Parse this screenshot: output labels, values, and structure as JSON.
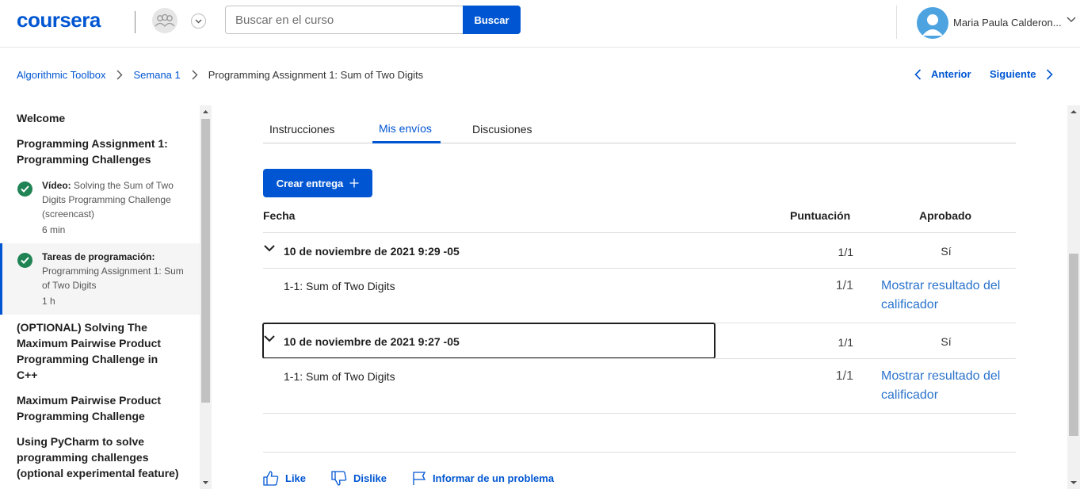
{
  "header": {
    "logo": "coursera",
    "search_placeholder": "Buscar en el curso",
    "search_button": "Buscar",
    "user_name": "Maria Paula Calderon..."
  },
  "breadcrumb": {
    "items": [
      "Algorithmic Toolbox",
      "Semana 1",
      "Programming Assignment 1: Sum of Two Digits"
    ],
    "prev": "Anterior",
    "next": "Siguiente"
  },
  "sidebar": {
    "welcome": "Welcome",
    "section1": "Programming Assignment 1: Programming Challenges",
    "items": [
      {
        "type": "Vídeo:",
        "title": "Solving the Sum of Two Digits Programming Challenge (screencast)",
        "duration": "6 min"
      },
      {
        "type": "Tareas de programación:",
        "title": "Programming Assignment 1: Sum of Two Digits",
        "duration": "1 h"
      }
    ],
    "section2": "(OPTIONAL) Solving The Maximum Pairwise Product Programming Challenge in C++",
    "section3": "Maximum Pairwise Product Programming Challenge",
    "section4": "Using PyCharm to solve programming challenges (optional experimental feature)"
  },
  "tabs": [
    "Instrucciones",
    "Mis envíos",
    "Discusiones"
  ],
  "create_button": "Crear entrega",
  "table": {
    "headers": {
      "date": "Fecha",
      "score": "Puntuación",
      "passed": "Aprobado"
    },
    "submissions": [
      {
        "date": "10 de noviembre de 2021 9:29 -05",
        "score": "1/1",
        "passed": "Sí",
        "part_name": "1-1: Sum of Two Digits",
        "part_score": "1/1",
        "part_link": "Mostrar resultado del calificador"
      },
      {
        "date": "10 de noviembre de 2021 9:27 -05",
        "score": "1/1",
        "passed": "Sí",
        "part_name": "1-1: Sum of Two Digits",
        "part_score": "1/1",
        "part_link": "Mostrar resultado del calificador"
      }
    ]
  },
  "footer": {
    "like": "Like",
    "dislike": "Dislike",
    "report": "Informar de un problema"
  },
  "colors": {
    "brand": "#0056d2",
    "success": "#1f8354"
  }
}
